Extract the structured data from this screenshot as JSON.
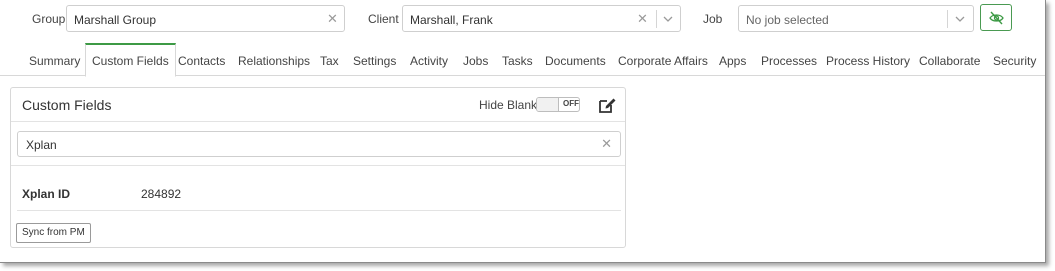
{
  "selectors": {
    "group": {
      "label": "Group",
      "value": "Marshall Group"
    },
    "client": {
      "label": "Client",
      "value": "Marshall, Frank"
    },
    "job": {
      "label": "Job",
      "placeholder": "No job selected"
    }
  },
  "tabs": [
    {
      "label": "Summary"
    },
    {
      "label": "Custom Fields",
      "active": true
    },
    {
      "label": "Contacts"
    },
    {
      "label": "Relationships"
    },
    {
      "label": "Tax"
    },
    {
      "label": "Settings"
    },
    {
      "label": "Activity"
    },
    {
      "label": "Jobs"
    },
    {
      "label": "Tasks"
    },
    {
      "label": "Documents"
    },
    {
      "label": "Corporate Affairs"
    },
    {
      "label": "Apps"
    },
    {
      "label": "Processes"
    },
    {
      "label": "Process History"
    },
    {
      "label": "Collaborate"
    },
    {
      "label": "Security"
    }
  ],
  "panel": {
    "title": "Custom Fields",
    "hide_blank_label": "Hide Blank",
    "hide_blank_state": "OFF",
    "search_value": "Xplan",
    "fields": [
      {
        "label": "Xplan ID",
        "value": "284892"
      }
    ],
    "sync_button": "Sync from PM"
  },
  "colors": {
    "accent": "#3d9a45",
    "border": "#d8d8d8"
  },
  "icons": {
    "clear": "close-icon",
    "dropdown": "chevron-down-icon",
    "visibility": "eye-slash-icon",
    "edit": "edit-icon"
  }
}
